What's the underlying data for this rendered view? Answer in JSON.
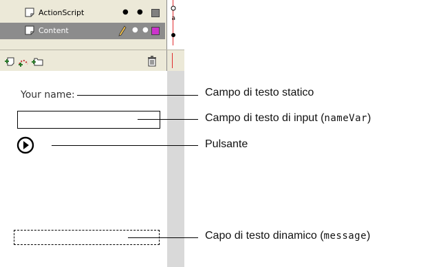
{
  "timeline": {
    "layers": [
      {
        "name": "ActionScript",
        "selected": false,
        "icon": "layer-icon",
        "color": "#808080"
      },
      {
        "name": "Content",
        "selected": true,
        "icon": "layer-icon",
        "editing": "pencil-icon",
        "color": "#cc33cc"
      }
    ],
    "toolbar_icons": [
      "insert-layer-icon",
      "add-motion-guide-icon",
      "insert-folder-icon",
      "delete-layer-icon"
    ]
  },
  "stage": {
    "static_label": "Your name:"
  },
  "callouts": {
    "static_text": "Campo di testo statico",
    "input_text": "Campo di testo di input (",
    "input_var": "nameVar",
    "input_close": ")",
    "button": "Pulsante",
    "dynamic_text": "Capo di testo dinamico (",
    "dynamic_var": "message",
    "dynamic_close": ")"
  },
  "colors": {
    "panel": "#ece9d8",
    "selected_row": "#8c8c8c",
    "pasteboard": "#d9d9d9",
    "playhead": "#e0292b"
  }
}
